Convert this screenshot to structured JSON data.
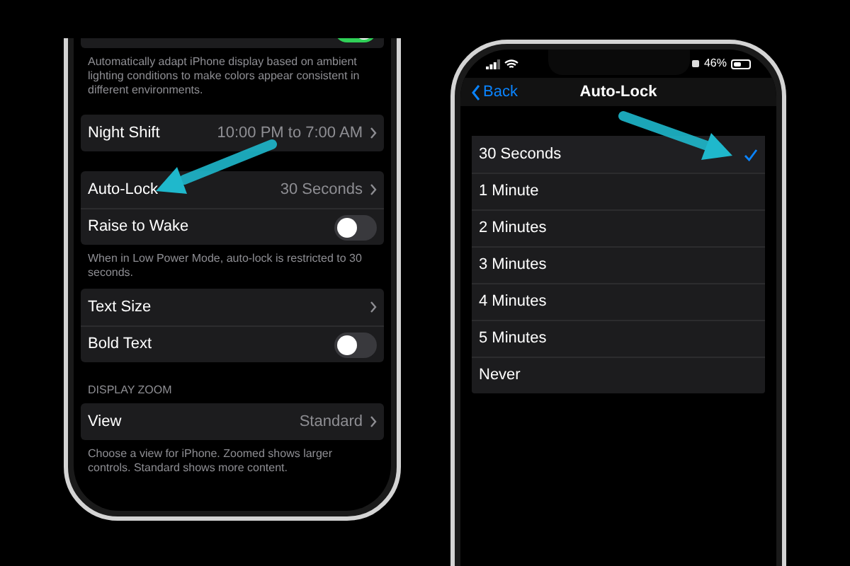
{
  "left_screen": {
    "sections": [
      {
        "rows": [
          {
            "kind": "toggle",
            "on": true
          }
        ],
        "footer": "Automatically adapt iPhone display based on ambient lighting conditions to make colors appear consistent in different environments."
      },
      {
        "rows": [
          {
            "kind": "link",
            "label": "Night Shift",
            "value": "10:00 PM to 7:00 AM"
          }
        ]
      },
      {
        "rows": [
          {
            "kind": "link",
            "label": "Auto-Lock",
            "value": "30 Seconds"
          },
          {
            "kind": "toggle",
            "label": "Raise to Wake",
            "on": false
          }
        ],
        "footer": "When in Low Power Mode, auto-lock is restricted to 30 seconds."
      },
      {
        "rows": [
          {
            "kind": "link",
            "label": "Text Size"
          },
          {
            "kind": "toggle",
            "label": "Bold Text",
            "on": false
          }
        ]
      },
      {
        "header": "DISPLAY ZOOM",
        "rows": [
          {
            "kind": "link",
            "label": "View",
            "value": "Standard"
          }
        ],
        "footer": "Choose a view for iPhone. Zoomed shows larger controls. Standard shows more content."
      }
    ]
  },
  "right_screen": {
    "status_bar": {
      "battery": "46%"
    },
    "nav": {
      "back": "Back",
      "title": "Auto-Lock"
    },
    "options": [
      {
        "label": "30 Seconds",
        "selected": true
      },
      {
        "label": "1 Minute",
        "selected": false
      },
      {
        "label": "2 Minutes",
        "selected": false
      },
      {
        "label": "3 Minutes",
        "selected": false
      },
      {
        "label": "4 Minutes",
        "selected": false
      },
      {
        "label": "5 Minutes",
        "selected": false
      },
      {
        "label": "Never",
        "selected": false
      }
    ]
  }
}
